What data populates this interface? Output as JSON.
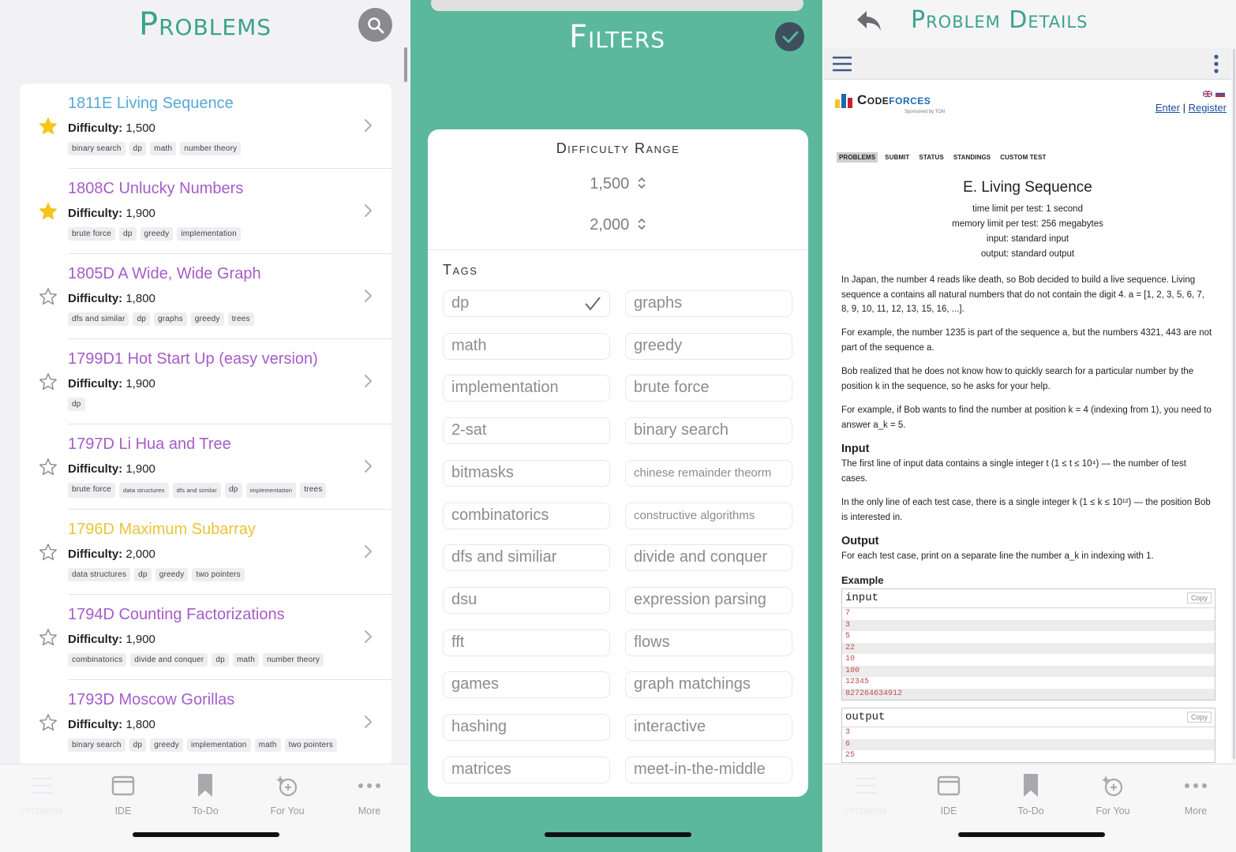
{
  "problems_screen": {
    "title": "Problems",
    "problems": [
      {
        "title": "1811E Living Sequence",
        "color": "#57a8d8",
        "starred": true,
        "difficulty_label": "Difficulty:",
        "difficulty": "1,500",
        "tags": [
          "binary search",
          "dp",
          "math",
          "number theory"
        ]
      },
      {
        "title": "1808C Unlucky Numbers",
        "color": "#a65cc9",
        "starred": true,
        "difficulty_label": "Difficulty:",
        "difficulty": "1,900",
        "tags": [
          "brute force",
          "dp",
          "greedy",
          "implementation"
        ]
      },
      {
        "title": "1805D A Wide, Wide Graph",
        "color": "#a65cc9",
        "starred": false,
        "difficulty_label": "Difficulty:",
        "difficulty": "1,800",
        "tags": [
          "dfs and similar",
          "dp",
          "graphs",
          "greedy",
          "trees"
        ]
      },
      {
        "title": "1799D1 Hot Start Up (easy version)",
        "color": "#a65cc9",
        "starred": false,
        "difficulty_label": "Difficulty:",
        "difficulty": "1,900",
        "tags": [
          "dp"
        ]
      },
      {
        "title": "1797D Li Hua and Tree",
        "color": "#a65cc9",
        "starred": false,
        "difficulty_label": "Difficulty:",
        "difficulty": "1,900",
        "tags": [
          "brute force",
          "data structures",
          "dfs and similar",
          "dp",
          "implementation",
          "trees"
        ]
      },
      {
        "title": "1796D Maximum Subarray",
        "color": "#ecc33a",
        "starred": false,
        "difficulty_label": "Difficulty:",
        "difficulty": "2,000",
        "tags": [
          "data structures",
          "dp",
          "greedy",
          "two pointers"
        ]
      },
      {
        "title": "1794D Counting Factorizations",
        "color": "#a65cc9",
        "starred": false,
        "difficulty_label": "Difficulty:",
        "difficulty": "1,900",
        "tags": [
          "combinatorics",
          "divide and conquer",
          "dp",
          "math",
          "number theory"
        ]
      },
      {
        "title": "1793D Moscow Gorillas",
        "color": "#a65cc9",
        "starred": false,
        "difficulty_label": "Difficulty:",
        "difficulty": "1,800",
        "tags": [
          "binary search",
          "dp",
          "greedy",
          "implementation",
          "math",
          "two pointers"
        ]
      }
    ]
  },
  "tabbar": {
    "tabs": [
      {
        "label": "Problems",
        "icon": "list-icon"
      },
      {
        "label": "IDE",
        "icon": "window-icon"
      },
      {
        "label": "To-Do",
        "icon": "bookmark-icon"
      },
      {
        "label": "For You",
        "icon": "sparkle-icon"
      },
      {
        "label": "More",
        "icon": "ellipsis-icon"
      }
    ]
  },
  "filters_screen": {
    "title": "Filters",
    "difficulty_range_label": "Difficulty Range",
    "min": "1,500",
    "max": "2,000",
    "tags_label": "Tags",
    "tags": [
      {
        "label": "dp",
        "selected": true
      },
      {
        "label": "graphs",
        "selected": false
      },
      {
        "label": "math",
        "selected": false
      },
      {
        "label": "greedy",
        "selected": false
      },
      {
        "label": "implementation",
        "selected": false
      },
      {
        "label": "brute force",
        "selected": false
      },
      {
        "label": "2-sat",
        "selected": false
      },
      {
        "label": "binary search",
        "selected": false
      },
      {
        "label": "bitmasks",
        "selected": false
      },
      {
        "label": "chinese remainder theorm",
        "selected": false
      },
      {
        "label": "combinatorics",
        "selected": false
      },
      {
        "label": "constructive algorithms",
        "selected": false
      },
      {
        "label": "dfs and similiar",
        "selected": false
      },
      {
        "label": "divide and conquer",
        "selected": false
      },
      {
        "label": "dsu",
        "selected": false
      },
      {
        "label": "expression parsing",
        "selected": false
      },
      {
        "label": "fft",
        "selected": false
      },
      {
        "label": "flows",
        "selected": false
      },
      {
        "label": "games",
        "selected": false
      },
      {
        "label": "graph matchings",
        "selected": false
      },
      {
        "label": "hashing",
        "selected": false
      },
      {
        "label": "interactive",
        "selected": false
      },
      {
        "label": "matrices",
        "selected": false
      },
      {
        "label": "meet-in-the-middle",
        "selected": false
      }
    ]
  },
  "details_screen": {
    "title": "Problem Details",
    "cf": {
      "logo_code": "Code",
      "logo_forces": "forces",
      "sponsor": "Sponsored by TON",
      "enter": "Enter",
      "separator": "|",
      "register": "Register",
      "menu": [
        "PROBLEMS",
        "SUBMIT",
        "STATUS",
        "STANDINGS",
        "CUSTOM TEST"
      ]
    },
    "problem": {
      "title": "E. Living Sequence",
      "time_limit": "time limit per test: 1 second",
      "memory_limit": "memory limit per test: 256 megabytes",
      "input": "input: standard input",
      "output": "output: standard output",
      "p1": "In Japan, the number 4 reads like death, so Bob decided to build a live sequence. Living sequence a contains all natural numbers that do not contain the digit 4. a = [1, 2, 3, 5, 6, 7, 8, 9, 10, 11, 12, 13, 15, 16, ...].",
      "p2": "For example, the number 1235 is part of the sequence a, but the numbers 4321, 443 are not part of the sequence a.",
      "p3": "Bob realized that he does not know how to quickly search for a particular number by the position k in the sequence, so he asks for your help.",
      "p4": "For example, if Bob wants to find the number at position k = 4 (indexing from 1), you need to answer a_k = 5.",
      "input_h": "Input",
      "input_p1": "The first line of input data contains a single integer t (1 ≤ t ≤ 10⁴) — the number of test cases.",
      "input_p2": "In the only line of each test case, there is a single integer k (1 ≤ k ≤ 10¹²) — the position Bob is interested in.",
      "output_h": "Output",
      "output_p": "For each test case, print on a separate line the number a_k in indexing with 1.",
      "example_h": "Example",
      "input_label": "input",
      "output_label": "output",
      "copy": "Copy",
      "input_lines": [
        "7",
        "3",
        "5",
        "22",
        "10",
        "100",
        "12345",
        "827264634912"
      ],
      "output_lines": [
        "3",
        "6",
        "25"
      ]
    }
  }
}
